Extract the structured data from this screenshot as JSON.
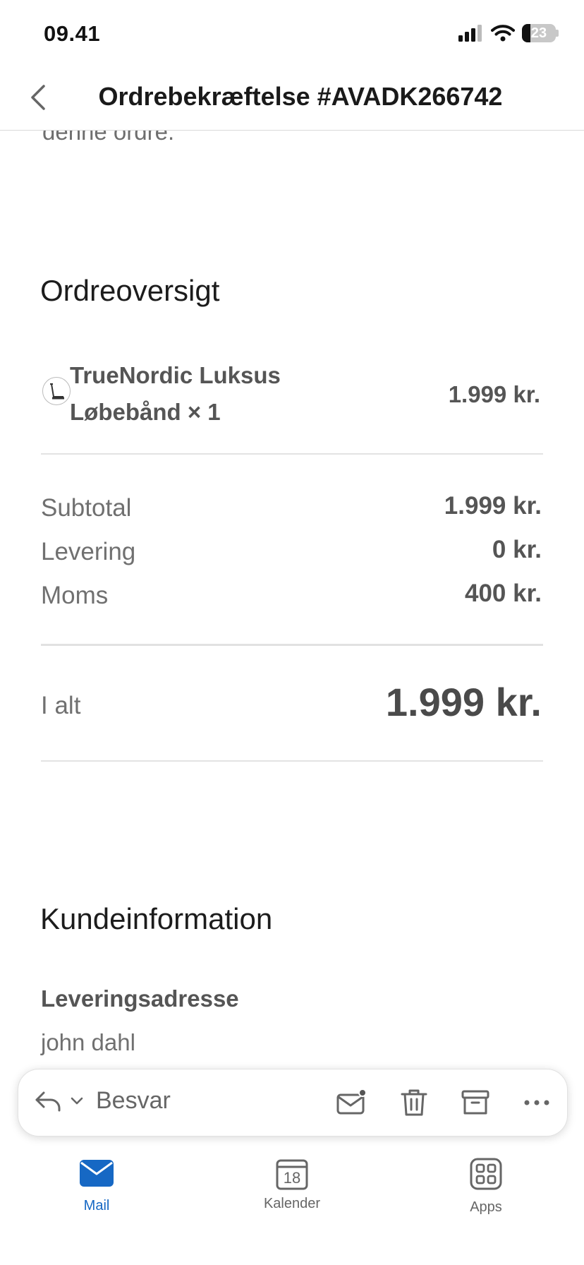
{
  "status_bar": {
    "time": "09.41",
    "battery": "23"
  },
  "nav": {
    "title": "Ordrebekræftelse #AVADK266742"
  },
  "content": {
    "cut_text": "denne ordre.",
    "order_overview_title": "Ordreoversigt",
    "item": {
      "name": "TrueNordic Luksus Løbebånd × 1",
      "price": "1.999 kr."
    },
    "summary": [
      {
        "label": "Subtotal",
        "value": "1.999 kr."
      },
      {
        "label": "Levering",
        "value": "0 kr."
      },
      {
        "label": "Moms",
        "value": "400 kr."
      }
    ],
    "total": {
      "label": "I alt",
      "value": "1.999 kr."
    },
    "customer_title": "Kundeinformation",
    "delivery_address_label": "Leveringsadresse",
    "delivery_name": "john dahl"
  },
  "action_bar": {
    "reply_label": "Besvar"
  },
  "tabs": [
    {
      "label": "Mail",
      "active": true
    },
    {
      "label": "Kalender",
      "calendar_day": "18",
      "active": false
    },
    {
      "label": "Apps",
      "active": false
    }
  ],
  "colors": {
    "accent": "#1668c4",
    "inactive": "#666666"
  }
}
